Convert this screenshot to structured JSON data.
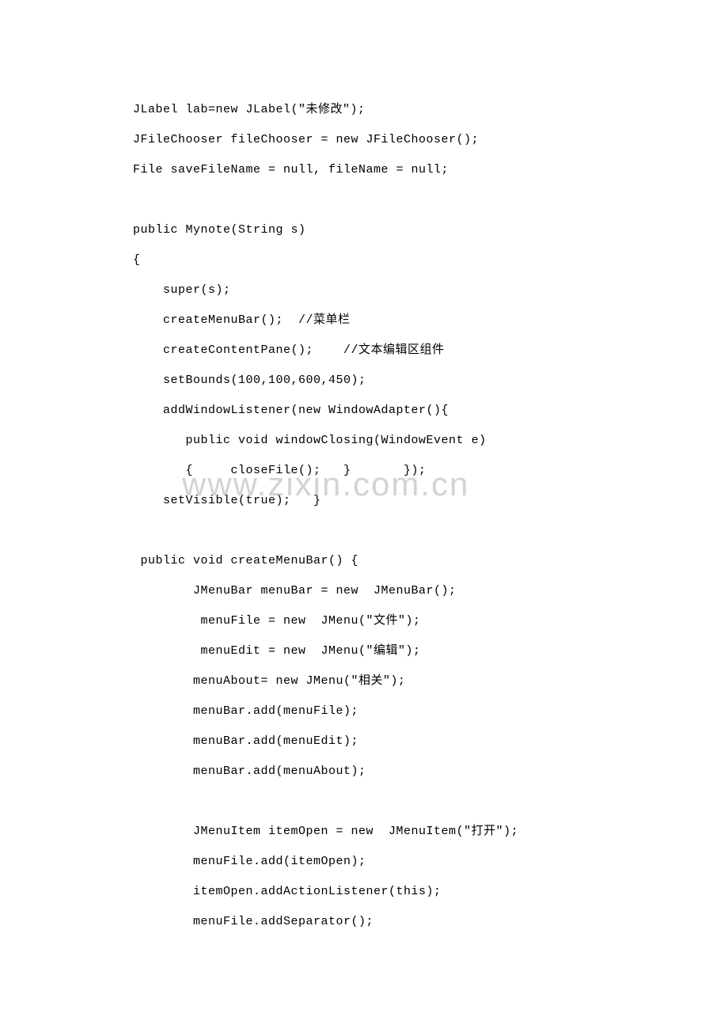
{
  "code": {
    "lines": [
      "JLabel lab=new JLabel(\"未修改\");",
      "JFileChooser fileChooser = new JFileChooser();",
      "File saveFileName = null, fileName = null;",
      "",
      "public Mynote(String s)",
      "{",
      "    super(s);",
      "    createMenuBar();  //菜单栏",
      "    createContentPane();    //文本编辑区组件",
      "    setBounds(100,100,600,450);",
      "    addWindowListener(new WindowAdapter(){",
      "       public void windowClosing(WindowEvent e)",
      "       {     closeFile();   }       });",
      "    setVisible(true);   }",
      "",
      " public void createMenuBar() {",
      "        JMenuBar menuBar = new  JMenuBar();",
      "         menuFile = new  JMenu(\"文件\");",
      "         menuEdit = new  JMenu(\"编辑\");",
      "        menuAbout= new JMenu(\"相关\");",
      "        menuBar.add(menuFile);",
      "        menuBar.add(menuEdit);",
      "        menuBar.add(menuAbout);",
      "",
      "        JMenuItem itemOpen = new  JMenuItem(\"打开\");",
      "        menuFile.add(itemOpen);",
      "        itemOpen.addActionListener(this);",
      "        menuFile.addSeparator();"
    ]
  },
  "watermark": {
    "text": "www.zixin.com.cn"
  }
}
